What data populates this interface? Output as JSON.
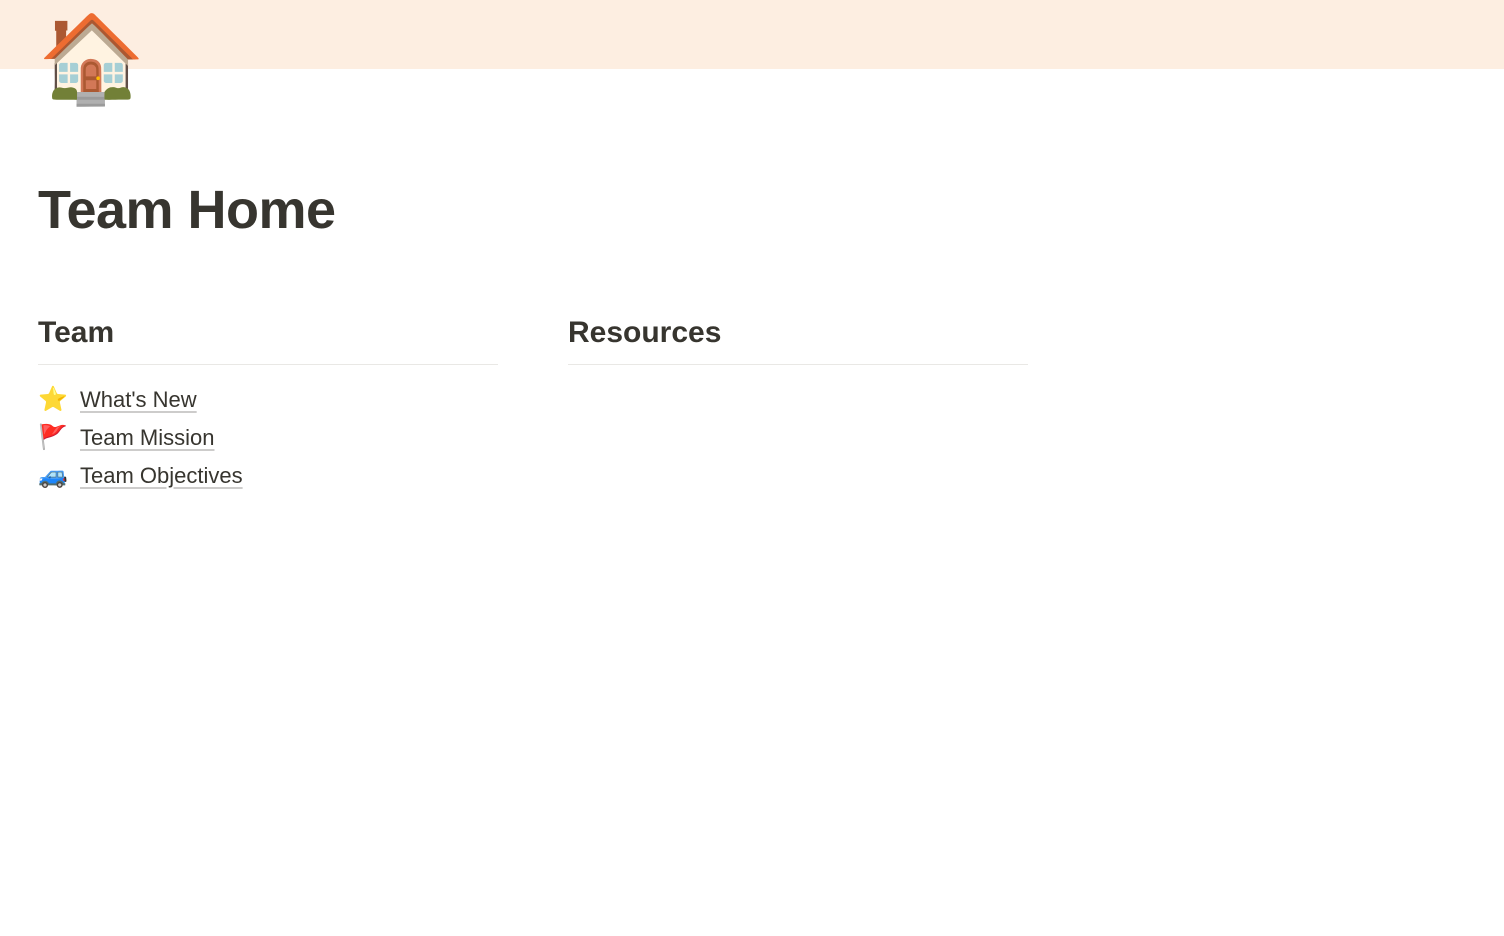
{
  "page": {
    "icon": "🏠",
    "title": "Team Home"
  },
  "sections": {
    "team": {
      "heading": "Team",
      "links": [
        {
          "icon": "⭐",
          "label": "What's New"
        },
        {
          "icon": "🚩",
          "label": "Team Mission"
        },
        {
          "icon": "🚙",
          "label": "Team Objectives"
        }
      ]
    },
    "resources": {
      "heading": "Resources"
    }
  }
}
